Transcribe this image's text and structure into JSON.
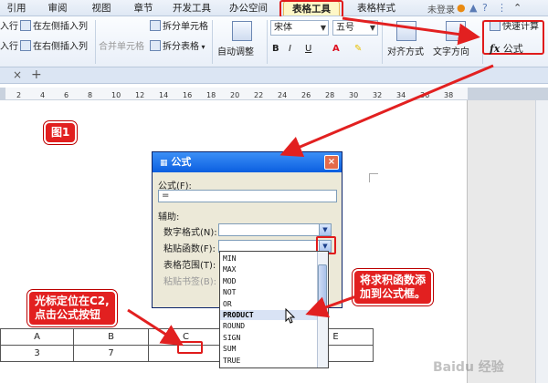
{
  "menu_tabs": [
    "引用",
    "审阅",
    "视图",
    "章节",
    "开发工具",
    "办公空间",
    "表格工具",
    "表格样式"
  ],
  "active_tab": "表格工具",
  "login_text": "未登录",
  "ribbon": {
    "insert_left": "在左侧插入列",
    "insert_right": "在右侧插入列",
    "insert_row_1": "入行",
    "insert_row_2": "入行",
    "merge_cells": "合并单元格",
    "split_cells": "拆分单元格",
    "split_table": "拆分表格",
    "auto_fit": "自动调整",
    "font_name": "宋体",
    "font_size": "五号",
    "bold": "B",
    "italic": "I",
    "underline": "U",
    "font_color": "A",
    "align": "对齐方式",
    "text_direction": "文字方向",
    "quick_calc": "快速计算",
    "formula_fx": "fx",
    "formula_label": "公式"
  },
  "ruler_numbers": [
    "2",
    "4",
    "6",
    "8",
    "10",
    "12",
    "14",
    "16",
    "18",
    "20",
    "22",
    "24",
    "26",
    "28",
    "30",
    "32",
    "34",
    "36",
    "38"
  ],
  "callouts": {
    "fig": "图1",
    "cursor": "光标定位在C2,\n点击公式按钮",
    "paste": "将求积函数添\n加到公式框。"
  },
  "dialog": {
    "title": "公式",
    "formula_label": "公式(F):",
    "formula_value": "=",
    "helper_label": "辅助:",
    "number_format_label": "数字格式(N):",
    "paste_function_label": "粘贴函数(F):",
    "table_range_label": "表格范围(T):",
    "bookmark_label": "粘贴书签(B):"
  },
  "function_list": [
    "MIN",
    "MAX",
    "MOD",
    "NOT",
    "OR",
    "PRODUCT",
    "ROUND",
    "SIGN",
    "SUM",
    "TRUE"
  ],
  "selected_function": "PRODUCT",
  "table": {
    "header": [
      "A",
      "B",
      "C",
      "D",
      "E"
    ],
    "row": [
      "3",
      "7",
      "",
      "",
      ""
    ]
  },
  "watermark": "Baidu 经验",
  "colors": {
    "callout": "#e22020",
    "title_bar": "#0b5fe0",
    "highlight": "#e01b1b"
  }
}
